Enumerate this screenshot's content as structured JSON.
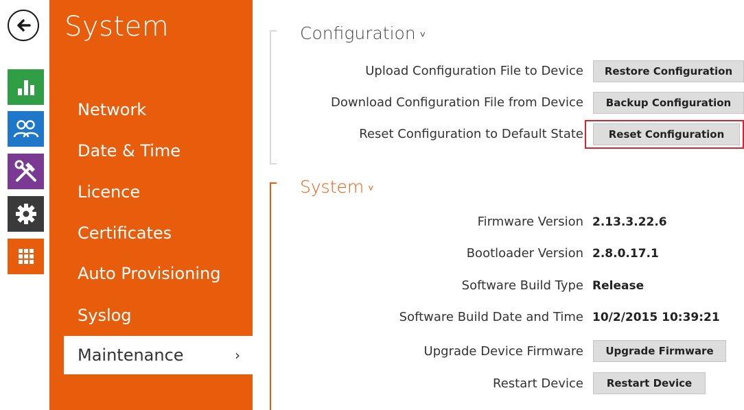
{
  "sidebar": {
    "title": "System",
    "items": [
      {
        "label": "Network"
      },
      {
        "label": "Date & Time"
      },
      {
        "label": "Licence"
      },
      {
        "label": "Certificates"
      },
      {
        "label": "Auto Provisioning"
      },
      {
        "label": "Syslog"
      },
      {
        "label": "Maintenance",
        "active": true,
        "chevron": "›"
      }
    ]
  },
  "rail": {
    "icons": [
      "back-arrow-icon",
      "bar-chart-icon",
      "users-icon",
      "tools-icon",
      "gear-icon",
      "grid-icon"
    ],
    "colors": {
      "status": "#2f9e44",
      "directory": "#1f77c9",
      "hardware": "#7a3a93",
      "services": "#3a3a3a",
      "system": "#e85d0c"
    }
  },
  "configuration": {
    "title": "Configuration",
    "title_chevron": "˅",
    "rows": [
      {
        "label": "Upload Configuration File to Device",
        "button": "Restore Configuration"
      },
      {
        "label": "Download Configuration File from Device",
        "button": "Backup Configuration"
      },
      {
        "label": "Reset Configuration to Default State",
        "button": "Reset Configuration"
      }
    ]
  },
  "system": {
    "title": "System",
    "title_chevron": "˅",
    "firmware_version": {
      "label": "Firmware Version",
      "value": "2.13.3.22.6"
    },
    "bootloader_version": {
      "label": "Bootloader Version",
      "value": "2.8.0.17.1"
    },
    "build_type": {
      "label": "Software Build Type",
      "value": "Release"
    },
    "build_date": {
      "label": "Software Build Date and Time",
      "value": "10/2/2015 10:39:21"
    },
    "upgrade": {
      "label": "Upgrade Device Firmware",
      "button": "Upgrade Firmware"
    },
    "restart": {
      "label": "Restart Device",
      "button": "Restart Device"
    }
  },
  "colors": {
    "accent": "#e85d0c",
    "highlight": "#d9232e",
    "button_bg": "#dddddd"
  }
}
